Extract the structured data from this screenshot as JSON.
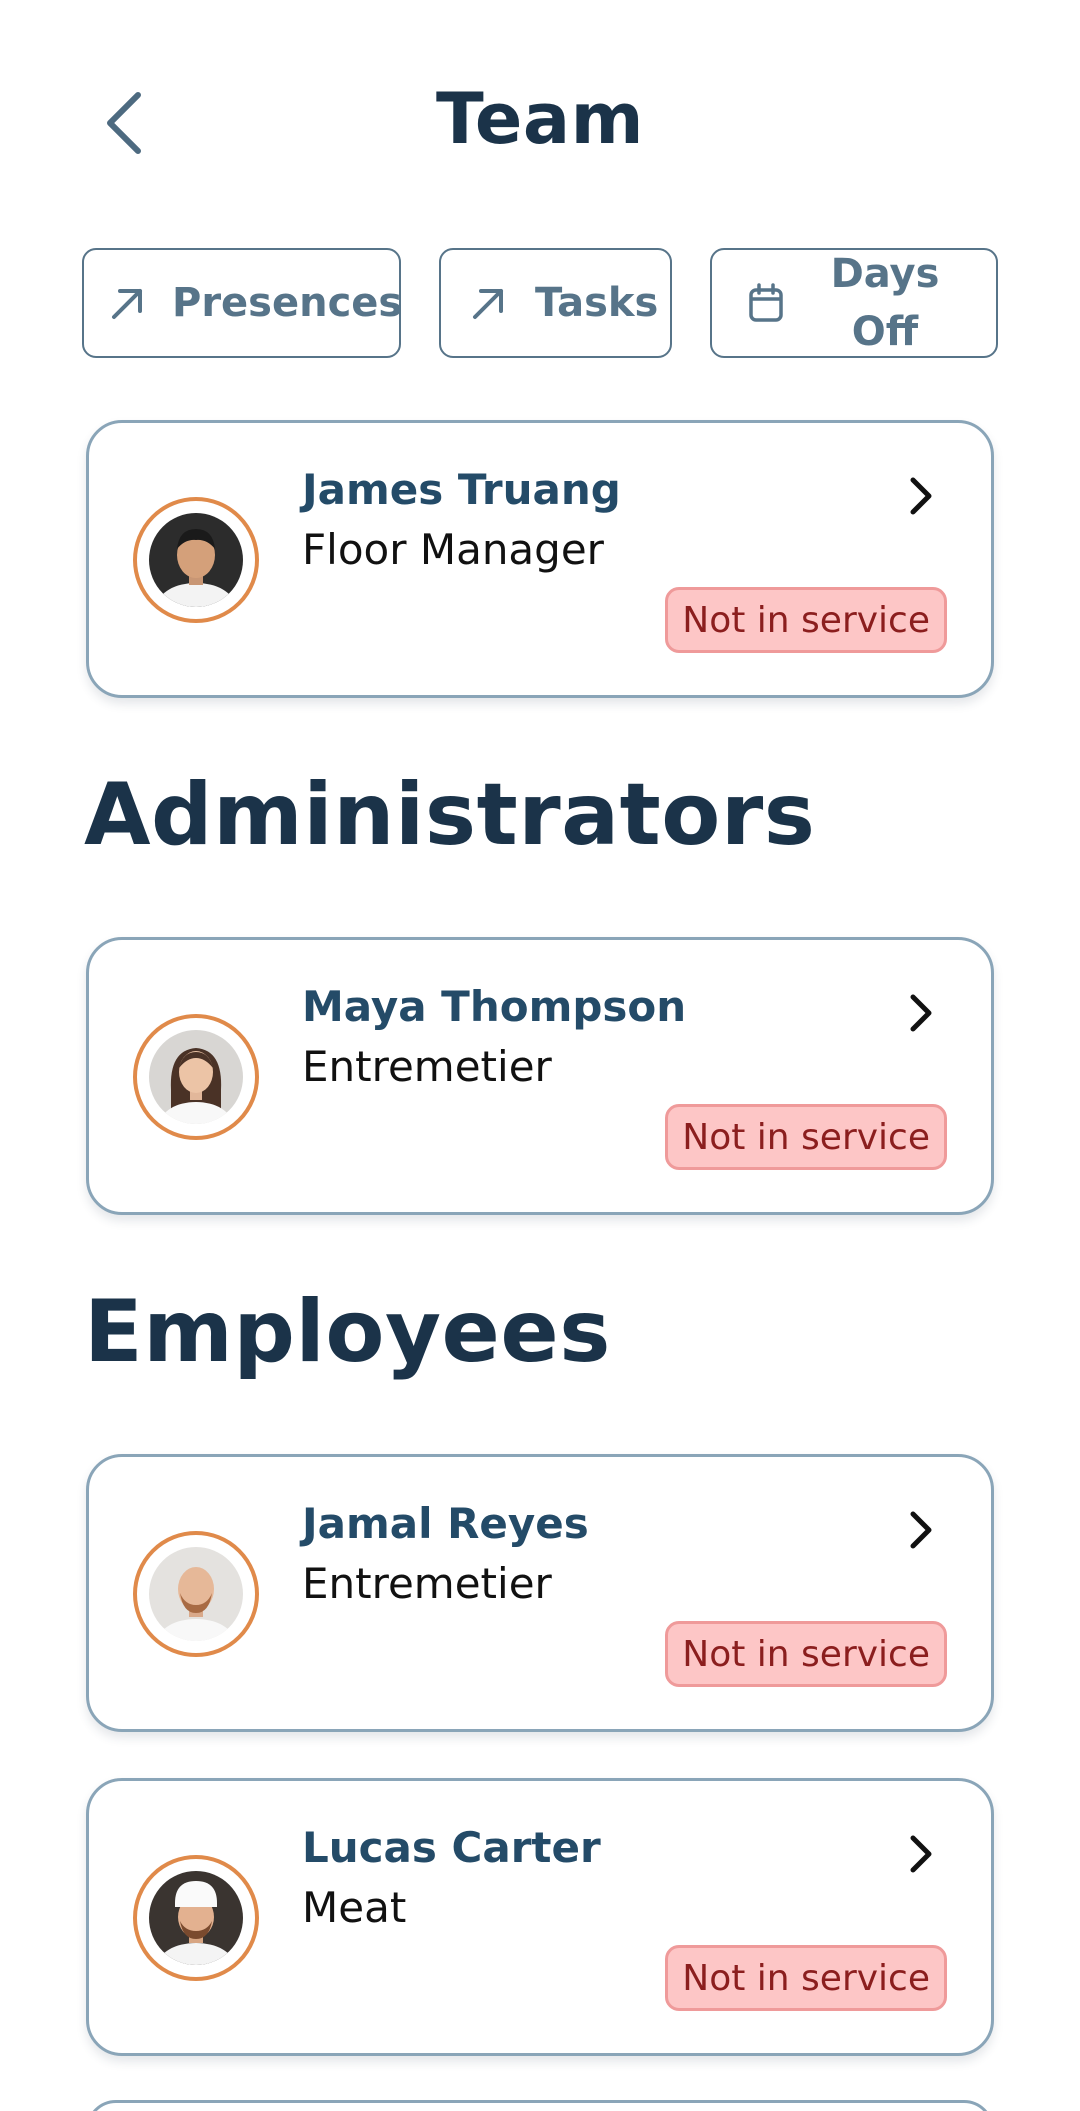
{
  "header": {
    "title": "Team",
    "back_icon": "chevron-left-icon"
  },
  "actions": {
    "presences": {
      "label": "Presences",
      "icon": "arrow-up-right-icon"
    },
    "tasks": {
      "label": "Tasks",
      "icon": "arrow-up-right-icon"
    },
    "days_off": {
      "label_line1": "Days",
      "label_line2": "Off",
      "icon": "calendar-icon"
    }
  },
  "manager": {
    "name": "James Truang",
    "role": "Floor Manager",
    "status": "Not in service"
  },
  "sections": {
    "administrators": "Administrators",
    "employees": "Employees"
  },
  "administrators": [
    {
      "name": "Maya Thompson",
      "role": "Entremetier",
      "status": "Not in service"
    }
  ],
  "employees": [
    {
      "name": "Jamal Reyes",
      "role": "Entremetier",
      "status": "Not in service"
    },
    {
      "name": "Lucas Carter",
      "role": "Meat",
      "status": "Not in service"
    }
  ],
  "colors": {
    "primary": "#1b3349",
    "accent_border": "#577489",
    "card_border": "#8aa5b8",
    "avatar_ring": "#e08a4a",
    "badge_bg": "#fdc6c6",
    "badge_text": "#8b1e1e"
  }
}
